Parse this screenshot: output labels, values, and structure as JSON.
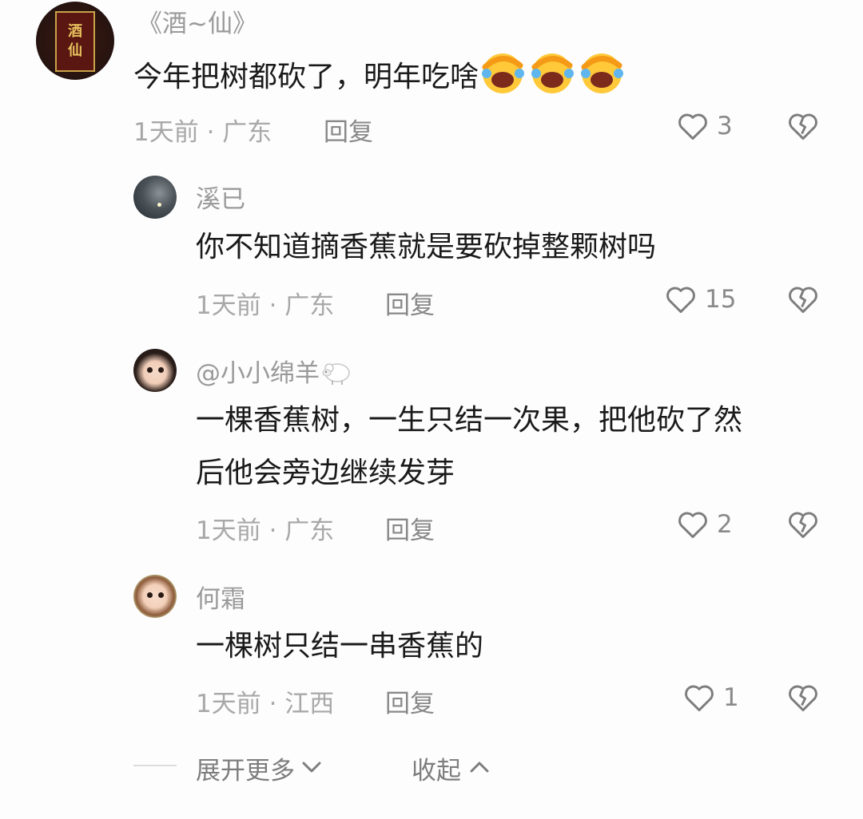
{
  "comments": [
    {
      "username": "《酒~仙》",
      "avatar_text": [
        "酒",
        "仙"
      ],
      "text": "今年把树都砍了，明年吃啥",
      "emoji": [
        "face-with-tears-of-joy-icon",
        "face-with-tears-of-joy-icon",
        "face-with-tears-of-joy-icon"
      ],
      "meta": "1天前 · 广东",
      "reply_label": "回复",
      "likes": "3"
    },
    {
      "username": "溪已",
      "text": "你不知道摘香蕉就是要砍掉整颗树吗",
      "meta": "1天前 · 广东",
      "reply_label": "回复",
      "likes": "15"
    },
    {
      "username": "@小小绵羊",
      "username_icon": "sheep-icon",
      "text_line1": "一棵香蕉树，一生只结一次果，把他砍了然",
      "text_line2": "后他会旁边继续发芽",
      "meta": "1天前 · 广东",
      "reply_label": "回复",
      "likes": "2"
    },
    {
      "username": "何霜",
      "text": "一棵树只结一串香蕉的",
      "meta": "1天前 · 江西",
      "reply_label": "回复",
      "likes": "1"
    }
  ],
  "footer": {
    "expand_label": "展开更多",
    "collapse_label": "收起"
  },
  "colors": {
    "background": "#fdfdfd",
    "text_primary": "#1a1a1a",
    "text_secondary": "#9a9a9a",
    "icon_gray": "#8a8a8a"
  }
}
